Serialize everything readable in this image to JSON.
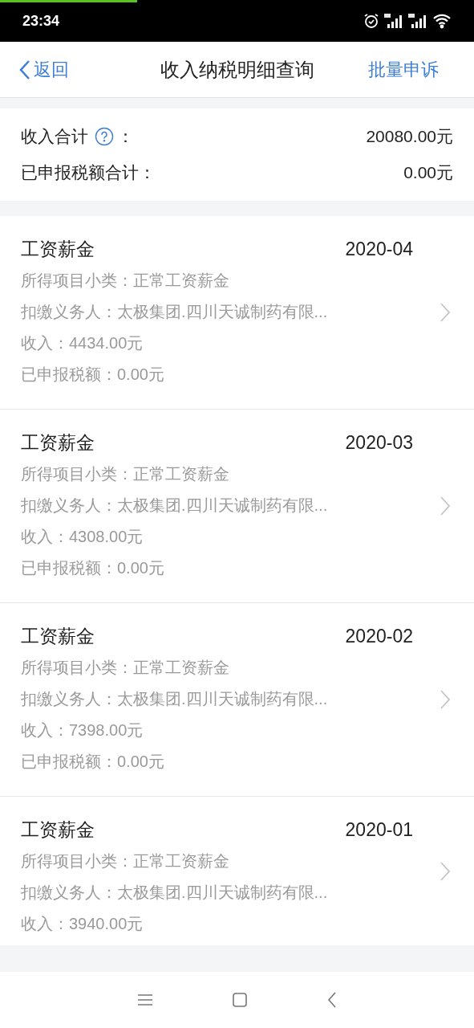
{
  "status_bar": {
    "time": "23:34"
  },
  "loading_bar": {
    "level": 0.29
  },
  "nav": {
    "back": "返回",
    "title": "收入纳税明细查询",
    "action": "批量申诉"
  },
  "summary": [
    {
      "label": "收入合计",
      "help": true,
      "colon": "：",
      "value": "20080.00元"
    },
    {
      "label": "已申报税额合计：",
      "help": false,
      "value": "0.00元"
    }
  ],
  "records": [
    {
      "title": "工资薪金",
      "period": "2020-04",
      "lines": [
        "所得项目小类：正常工资薪金",
        "扣缴义务人：太极集团.四川天诚制药有限...",
        "收入：4434.00元",
        "已申报税额：0.00元"
      ]
    },
    {
      "title": "工资薪金",
      "period": "2020-03",
      "lines": [
        "所得项目小类：正常工资薪金",
        "扣缴义务人：太极集团.四川天诚制药有限...",
        "收入：4308.00元",
        "已申报税额：0.00元"
      ]
    },
    {
      "title": "工资薪金",
      "period": "2020-02",
      "lines": [
        "所得项目小类：正常工资薪金",
        "扣缴义务人：太极集团.四川天诚制药有限...",
        "收入：7398.00元",
        "已申报税额：0.00元"
      ]
    },
    {
      "title": "工资薪金",
      "period": "2020-01",
      "lines": [
        "所得项目小类：正常工资薪金",
        "扣缴义务人：太极集团.四川天诚制药有限...",
        "收入：3940.00元"
      ]
    }
  ]
}
